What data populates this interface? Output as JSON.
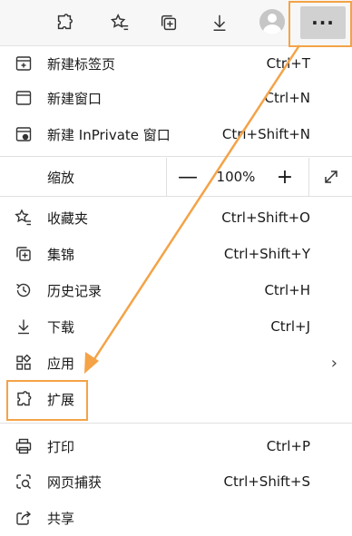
{
  "toolbar": {
    "icons": [
      "extensions-icon",
      "favorites-star-icon",
      "collections-icon",
      "download-icon"
    ],
    "more_label": "···"
  },
  "menu": {
    "new_tab": {
      "label": "新建标签页",
      "shortcut": "Ctrl+T"
    },
    "new_window": {
      "label": "新建窗口",
      "shortcut": "Ctrl+N"
    },
    "new_inprivate": {
      "label": "新建 InPrivate 窗口",
      "shortcut": "Ctrl+Shift+N"
    },
    "zoom": {
      "label": "缩放",
      "minus": "—",
      "value": "100%",
      "plus": "+"
    },
    "favorites": {
      "label": "收藏夹",
      "shortcut": "Ctrl+Shift+O"
    },
    "collections": {
      "label": "集锦",
      "shortcut": "Ctrl+Shift+Y"
    },
    "history": {
      "label": "历史记录",
      "shortcut": "Ctrl+H"
    },
    "downloads": {
      "label": "下载",
      "shortcut": "Ctrl+J"
    },
    "apps": {
      "label": "应用",
      "chevron": "›"
    },
    "extensions": {
      "label": "扩展"
    },
    "print": {
      "label": "打印",
      "shortcut": "Ctrl+P"
    },
    "web_capture": {
      "label": "网页捕获",
      "shortcut": "Ctrl+Shift+S"
    },
    "share": {
      "label": "共享"
    }
  },
  "colors": {
    "annotation": "#f4a347",
    "toolbar_bg": "#f7f7f7",
    "more_active_bg": "#d1d1d1"
  }
}
